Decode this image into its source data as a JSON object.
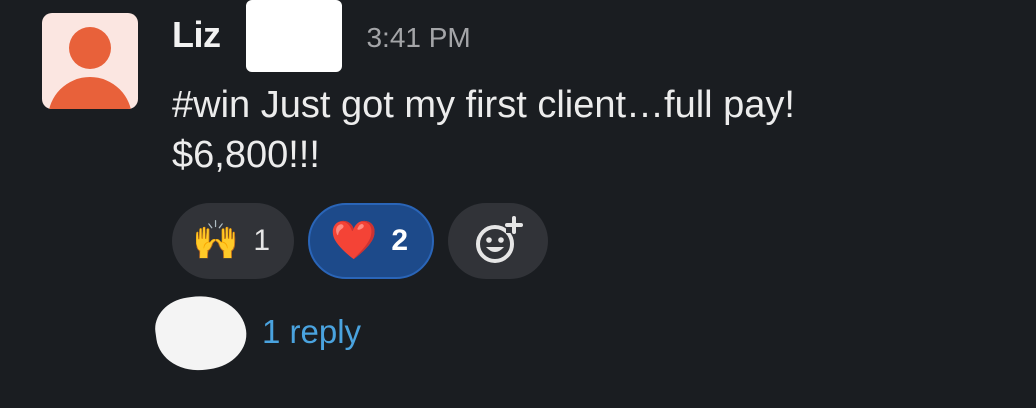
{
  "message": {
    "sender": "Liz",
    "time": "3:41 PM",
    "text_line1": "#win Just got my first client…full pay!",
    "text_line2": "$6,800!!!"
  },
  "reactions": [
    {
      "emoji": "🙌",
      "emoji_name": "raised-hands-icon",
      "count": "1",
      "selected": false
    },
    {
      "emoji": "❤️",
      "emoji_name": "heart-icon",
      "count": "2",
      "selected": true
    }
  ],
  "add_reaction": {
    "icon": "add-reaction-icon"
  },
  "thread": {
    "reply_text": "1 reply"
  },
  "colors": {
    "background": "#1a1d21",
    "avatar_bg": "#fbe6e1",
    "avatar_fg": "#e8613a",
    "reaction_pill": "#313338",
    "reaction_active": "#1d4a8a",
    "link": "#4aa3df",
    "timestamp": "#a4a5a8"
  }
}
